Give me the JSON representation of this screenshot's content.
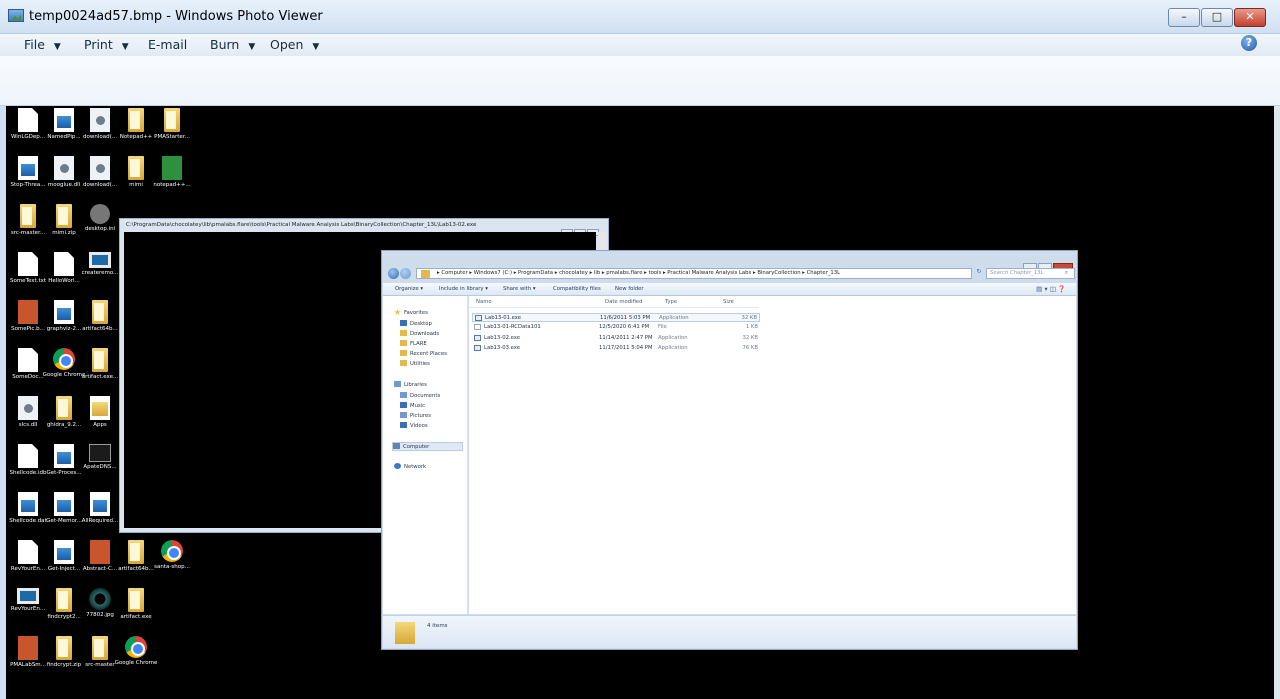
{
  "window": {
    "title": "temp0024ad57.bmp - Windows Photo Viewer",
    "min_label": "–",
    "max_label": "□",
    "close_label": "✕"
  },
  "menu": {
    "file": "File",
    "print": "Print",
    "email": "E-mail",
    "burn": "Burn",
    "open": "Open",
    "help": "?"
  },
  "desktop_icons": [
    {
      "label": "WinLGDep...",
      "icon": "file-icon"
    },
    {
      "label": "NamedPip...",
      "icon": "image-icon"
    },
    {
      "label": "download(...",
      "icon": "dll-icon"
    },
    {
      "label": "Notepad++",
      "icon": "folder-icon"
    },
    {
      "label": "PMAStarter...",
      "icon": "folder-icon"
    },
    {
      "label": "Stop-Threa...",
      "icon": "image-icon"
    },
    {
      "label": "mooglue.dll",
      "icon": "dll-icon"
    },
    {
      "label": "download(...",
      "icon": "dll-icon"
    },
    {
      "label": "mimi",
      "icon": "folder-icon"
    },
    {
      "label": "notepad++...",
      "icon": "notepad-icon"
    },
    {
      "label": "src-master...",
      "icon": "folder-icon"
    },
    {
      "label": "mimi.zip",
      "icon": "folder-icon"
    },
    {
      "label": "desktop.ini",
      "icon": "gear-icon"
    },
    {
      "label": "SomeText.txt",
      "icon": "file-icon"
    },
    {
      "label": "HelloWorl...",
      "icon": "file-icon"
    },
    {
      "label": "createremo...",
      "icon": "window-icon"
    },
    {
      "label": "SomePic.b...",
      "icon": "picture-icon"
    },
    {
      "label": "graphviz-2...",
      "icon": "installer-icon"
    },
    {
      "label": "artifact64b...",
      "icon": "folder-icon"
    },
    {
      "label": "SomeDoc...",
      "icon": "document-icon"
    },
    {
      "label": "Google Chrome",
      "icon": "chrome-icon"
    },
    {
      "label": "artifact.exe...",
      "icon": "folder-icon"
    },
    {
      "label": "slcs.dll",
      "icon": "dll-icon"
    },
    {
      "label": "ghidra_9.2...",
      "icon": "folder-icon"
    },
    {
      "label": "Apps",
      "icon": "apps-icon"
    },
    {
      "label": "Shellcode.idb",
      "icon": "file-icon"
    },
    {
      "label": "Get-Proces...",
      "icon": "image-icon"
    },
    {
      "label": "ApateDNS...",
      "icon": "cmd-icon"
    },
    {
      "label": "Shellcode.dat",
      "icon": "image-icon"
    },
    {
      "label": "Get-Memor...",
      "icon": "image-icon"
    },
    {
      "label": "AllRequired...",
      "icon": "image-icon"
    },
    {
      "label": "RevYourEn...",
      "icon": "file-icon"
    },
    {
      "label": "Get-Inject...",
      "icon": "image-icon"
    },
    {
      "label": "Abstract-C...",
      "icon": "picture-icon"
    },
    {
      "label": "artifact64b...",
      "icon": "folder-icon"
    },
    {
      "label": "santa-shop...",
      "icon": "globe-icon"
    },
    {
      "label": "RevYourEn...",
      "icon": "window-icon"
    },
    {
      "label": "findcrypt2...",
      "icon": "folder-icon"
    },
    {
      "label": "77802.jpg",
      "icon": "ring-icon"
    },
    {
      "label": "artifact.exe",
      "icon": "folder-icon"
    },
    {
      "label": "PMALabSm...",
      "icon": "picture-icon"
    },
    {
      "label": "findcrypt.zip",
      "icon": "folder-icon"
    },
    {
      "label": "src-master",
      "icon": "folder-icon"
    },
    {
      "label": "Google Chrome",
      "icon": "chrome-icon"
    }
  ],
  "console": {
    "title": "C:\\ProgramData\\chocolatey\\lib\\pmalabs.flare\\tools\\Practical Malware Analysis Labs\\BinaryCollection\\Chapter_13L\\Lab13-02.exe"
  },
  "explorer": {
    "breadcrumb": "▸ Computer ▸ Windows7 (C:) ▸ ProgramData ▸ chocolatey ▸ lib ▸ pmalabs.flare ▸ tools ▸ Practical Malware Analysis Labs ▸ BinaryCollection ▸ Chapter_13L",
    "search_placeholder": "Search Chapter_13L",
    "commands": {
      "organize": "Organize ▾",
      "include": "Include in library ▾",
      "share": "Share with ▾",
      "compat": "Compatibility files",
      "newfolder": "New folder"
    },
    "nav": {
      "favorites": "Favorites",
      "desktop": "Desktop",
      "downloads": "Downloads",
      "flare": "FLARE",
      "recent": "Recent Places",
      "utilities": "Utilities",
      "libraries": "Libraries",
      "documents": "Documents",
      "music": "Music",
      "pictures": "Pictures",
      "videos": "Videos",
      "computer": "Computer",
      "network": "Network"
    },
    "columns": {
      "name": "Name",
      "date": "Date modified",
      "type": "Type",
      "size": "Size"
    },
    "files": [
      {
        "name": "Lab13-01.exe",
        "date": "11/6/2011 5:03 PM",
        "type": "Application",
        "size": "32 KB"
      },
      {
        "name": "Lab13-01-RCData101",
        "date": "12/5/2020 6:41 PM",
        "type": "File",
        "size": "1 KB"
      },
      {
        "name": "Lab13-02.exe",
        "date": "11/14/2011 2:47 PM",
        "type": "Application",
        "size": "32 KB"
      },
      {
        "name": "Lab13-03.exe",
        "date": "11/17/2011 5:04 PM",
        "type": "Application",
        "size": "76 KB"
      }
    ],
    "item_count": "4 items"
  }
}
